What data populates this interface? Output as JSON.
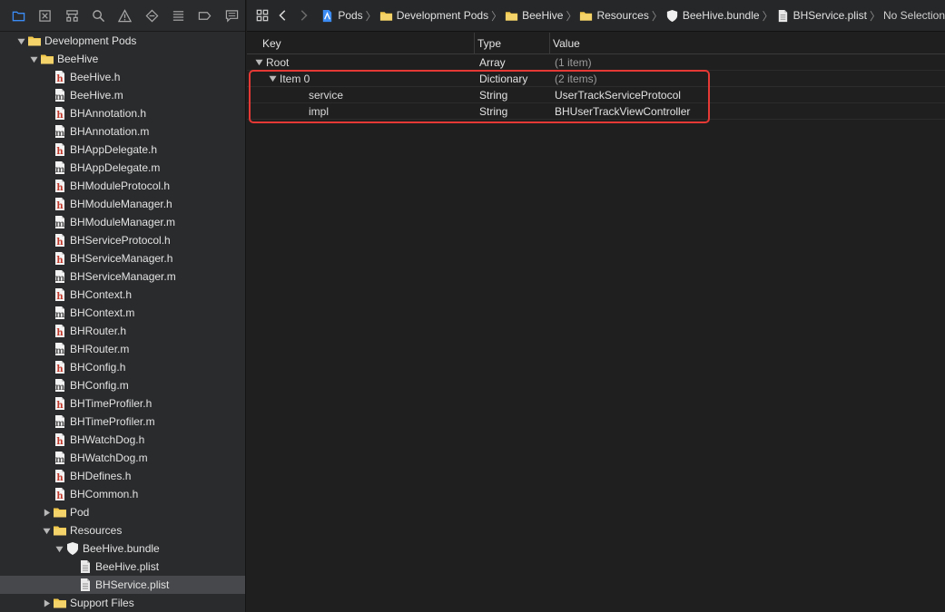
{
  "sidebar": {
    "tabs": [
      "folder-icon",
      "source-control-icon",
      "hierarchy-icon",
      "search-icon",
      "warning-icon",
      "test-icon",
      "debug-icon",
      "breakpoint-icon",
      "report-icon"
    ],
    "tree": [
      {
        "label": "Development Pods",
        "kind": "folder",
        "depth": 0,
        "disc": "open"
      },
      {
        "label": "BeeHive",
        "kind": "folder",
        "depth": 1,
        "disc": "open"
      },
      {
        "label": "BeeHive.h",
        "kind": "h",
        "depth": 2
      },
      {
        "label": "BeeHive.m",
        "kind": "m",
        "depth": 2
      },
      {
        "label": "BHAnnotation.h",
        "kind": "h",
        "depth": 2
      },
      {
        "label": "BHAnnotation.m",
        "kind": "m",
        "depth": 2
      },
      {
        "label": "BHAppDelegate.h",
        "kind": "h",
        "depth": 2
      },
      {
        "label": "BHAppDelegate.m",
        "kind": "m",
        "depth": 2
      },
      {
        "label": "BHModuleProtocol.h",
        "kind": "h",
        "depth": 2
      },
      {
        "label": "BHModuleManager.h",
        "kind": "h",
        "depth": 2
      },
      {
        "label": "BHModuleManager.m",
        "kind": "m",
        "depth": 2
      },
      {
        "label": "BHServiceProtocol.h",
        "kind": "h",
        "depth": 2
      },
      {
        "label": "BHServiceManager.h",
        "kind": "h",
        "depth": 2
      },
      {
        "label": "BHServiceManager.m",
        "kind": "m",
        "depth": 2
      },
      {
        "label": "BHContext.h",
        "kind": "h",
        "depth": 2
      },
      {
        "label": "BHContext.m",
        "kind": "m",
        "depth": 2
      },
      {
        "label": "BHRouter.h",
        "kind": "h",
        "depth": 2
      },
      {
        "label": "BHRouter.m",
        "kind": "m",
        "depth": 2
      },
      {
        "label": "BHConfig.h",
        "kind": "h",
        "depth": 2
      },
      {
        "label": "BHConfig.m",
        "kind": "m",
        "depth": 2
      },
      {
        "label": "BHTimeProfiler.h",
        "kind": "h",
        "depth": 2
      },
      {
        "label": "BHTimeProfiler.m",
        "kind": "m",
        "depth": 2
      },
      {
        "label": "BHWatchDog.h",
        "kind": "h",
        "depth": 2
      },
      {
        "label": "BHWatchDog.m",
        "kind": "m",
        "depth": 2
      },
      {
        "label": "BHDefines.h",
        "kind": "h",
        "depth": 2
      },
      {
        "label": "BHCommon.h",
        "kind": "h",
        "depth": 2
      },
      {
        "label": "Pod",
        "kind": "folder",
        "depth": 2,
        "disc": "closed"
      },
      {
        "label": "Resources",
        "kind": "folder",
        "depth": 2,
        "disc": "open"
      },
      {
        "label": "BeeHive.bundle",
        "kind": "bundle",
        "depth": 3,
        "disc": "open"
      },
      {
        "label": "BeeHive.plist",
        "kind": "plist",
        "depth": 4
      },
      {
        "label": "BHService.plist",
        "kind": "plist",
        "depth": 4,
        "selected": true
      },
      {
        "label": "Support Files",
        "kind": "folder",
        "depth": 2,
        "disc": "closed"
      }
    ]
  },
  "jumpbar": {
    "crumbs": [
      {
        "label": "Pods",
        "icon": "project-icon"
      },
      {
        "label": "Development Pods",
        "icon": "folder-icon"
      },
      {
        "label": "BeeHive",
        "icon": "folder-icon"
      },
      {
        "label": "Resources",
        "icon": "folder-icon"
      },
      {
        "label": "BeeHive.bundle",
        "icon": "bundle-icon"
      },
      {
        "label": "BHService.plist",
        "icon": "plist-icon"
      }
    ],
    "last": "No Selection"
  },
  "plist": {
    "headers": {
      "key": "Key",
      "type": "Type",
      "value": "Value"
    },
    "rows": [
      {
        "key": "Root",
        "type": "Array",
        "value": "(1 item)",
        "depth": 0,
        "disc": "open",
        "dim": true
      },
      {
        "key": "Item 0",
        "type": "Dictionary",
        "value": "(2 items)",
        "depth": 1,
        "disc": "open",
        "dim": true
      },
      {
        "key": "service",
        "type": "String",
        "value": "UserTrackServiceProtocol",
        "depth": 2
      },
      {
        "key": "impl",
        "type": "String",
        "value": "BHUserTrackViewController",
        "depth": 2
      }
    ]
  },
  "colors": {
    "folder": "#f2c94c",
    "h_file_mark": "#c0392b",
    "m_file_mark": "#555555",
    "accent_blue": "#3b8cf5",
    "highlight": "#e53935"
  }
}
